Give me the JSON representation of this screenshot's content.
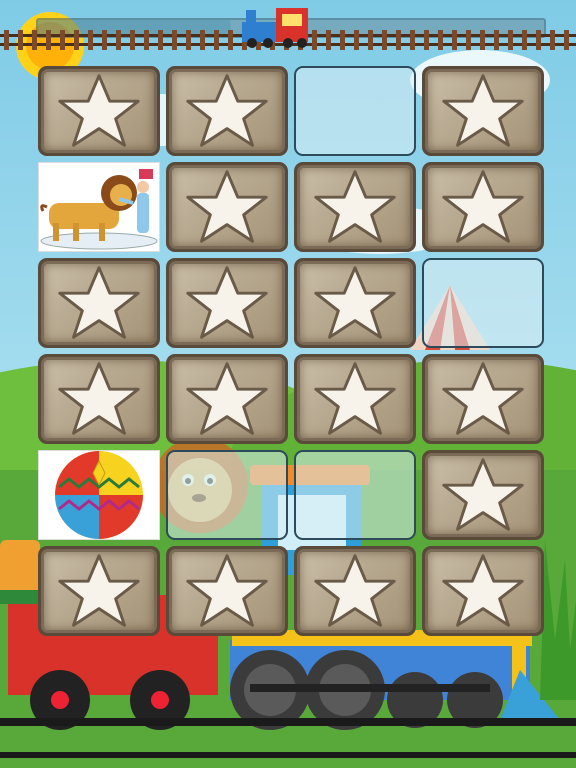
{
  "game": {
    "type": "memory-match",
    "rows": 6,
    "cols": 4,
    "progress_percent": 38
  },
  "cards": [
    {
      "state": "facedown",
      "icon": "star-icon"
    },
    {
      "state": "facedown",
      "icon": "star-icon"
    },
    {
      "state": "matched",
      "icon": ""
    },
    {
      "state": "facedown",
      "icon": "star-icon"
    },
    {
      "state": "faceup",
      "icon": "lion-tamer-picture"
    },
    {
      "state": "facedown",
      "icon": "star-icon"
    },
    {
      "state": "facedown",
      "icon": "star-icon"
    },
    {
      "state": "facedown",
      "icon": "star-icon"
    },
    {
      "state": "facedown",
      "icon": "star-icon"
    },
    {
      "state": "facedown",
      "icon": "star-icon"
    },
    {
      "state": "facedown",
      "icon": "star-icon"
    },
    {
      "state": "matched",
      "icon": ""
    },
    {
      "state": "facedown",
      "icon": "star-icon"
    },
    {
      "state": "facedown",
      "icon": "star-icon"
    },
    {
      "state": "facedown",
      "icon": "star-icon"
    },
    {
      "state": "facedown",
      "icon": "star-icon"
    },
    {
      "state": "faceup",
      "icon": "circus-ball-picture"
    },
    {
      "state": "matched",
      "icon": ""
    },
    {
      "state": "matched",
      "icon": ""
    },
    {
      "state": "facedown",
      "icon": "star-icon"
    },
    {
      "state": "facedown",
      "icon": "star-icon"
    },
    {
      "state": "facedown",
      "icon": "star-icon"
    },
    {
      "state": "facedown",
      "icon": "star-icon"
    },
    {
      "state": "facedown",
      "icon": "star-icon"
    }
  ],
  "colors": {
    "sky": "#9fd7ea",
    "grass": "#5aa83a",
    "wood": "#bcae95",
    "train_red": "#d8322a",
    "rail": "#2b2b2b"
  }
}
